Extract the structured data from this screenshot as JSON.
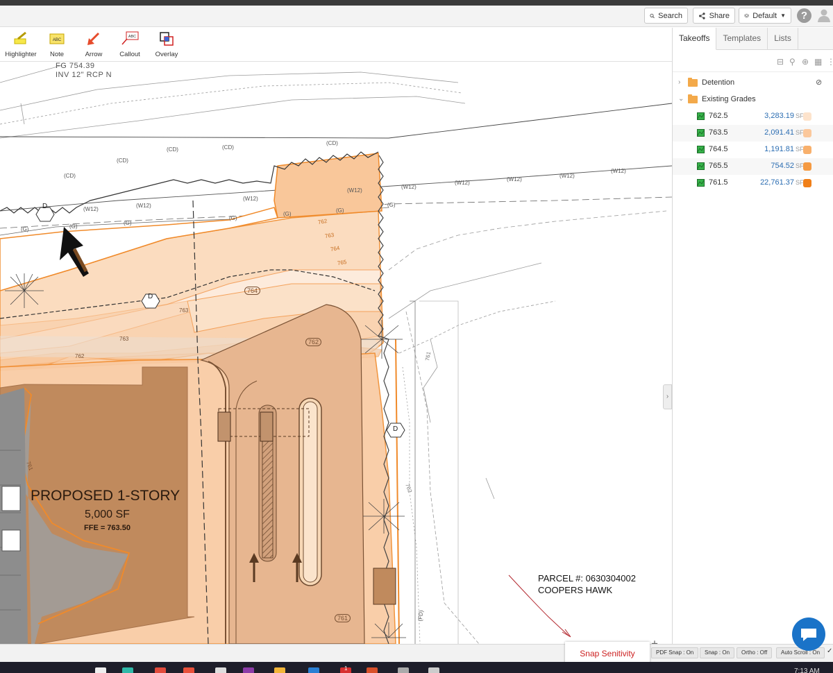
{
  "header": {
    "search_label": "Search",
    "share_label": "Share",
    "layers_label": "Default",
    "help_label": "?"
  },
  "toolbar": {
    "tools": [
      {
        "label": "Highlighter",
        "icon": "highlighter-icon"
      },
      {
        "label": "Note",
        "icon": "note-icon",
        "glyph": "ABC"
      },
      {
        "label": "Arrow",
        "icon": "arrow-icon"
      },
      {
        "label": "Callout",
        "icon": "callout-icon",
        "glyph": "ABC"
      },
      {
        "label": "Overlay",
        "icon": "overlay-icon"
      }
    ]
  },
  "panel": {
    "tabs": [
      {
        "label": "Takeoffs",
        "active": true
      },
      {
        "label": "Templates",
        "active": false
      },
      {
        "label": "Lists",
        "active": false
      }
    ],
    "folders": [
      {
        "label": "Detention",
        "expanded": false
      },
      {
        "label": "Existing Grades",
        "expanded": true
      }
    ],
    "items": [
      {
        "label": "762.5",
        "value": "3,283.19",
        "unit": "SF",
        "color": "#fde3cc"
      },
      {
        "label": "763.5",
        "value": "2,091.41",
        "unit": "SF",
        "color": "#fbc89c"
      },
      {
        "label": "764.5",
        "value": "1,191.81",
        "unit": "SF",
        "color": "#f8b06c"
      },
      {
        "label": "765.5",
        "value": "754.52",
        "unit": "SF",
        "color": "#f59a42"
      },
      {
        "label": "761.5",
        "value": "22,761.37",
        "unit": "SF",
        "color": "#f07f18"
      }
    ]
  },
  "plan": {
    "fg_label": "FG 754.39",
    "inv_label": "INV 12\" RCP N",
    "building_title": "PROPOSED 1-STORY",
    "building_area": "5,000 SF",
    "building_ffe": "FFE = 763.50",
    "parcel_line1": "PARCEL #: 0630304002",
    "parcel_line2": "COOPERS HAWK",
    "contours": [
      "762",
      "763",
      "764",
      "765",
      "764",
      "763",
      "762",
      "763",
      "762",
      "761",
      "761",
      "762",
      "761"
    ],
    "line_tags": [
      "(CD)",
      "(W12)",
      "(G)",
      "(FD)"
    ],
    "markers": [
      "D"
    ]
  },
  "zoom": {
    "in": "+",
    "out": "−"
  },
  "status": {
    "snap_sensitivity": "Snap Senitivity",
    "buttons": [
      "PDF Snap : On",
      "Snap : On",
      "Ortho : Off",
      "Auto Scroll : On"
    ],
    "check": "✓"
  },
  "taskbar": {
    "clock": "7:13 AM",
    "badge": "1"
  }
}
